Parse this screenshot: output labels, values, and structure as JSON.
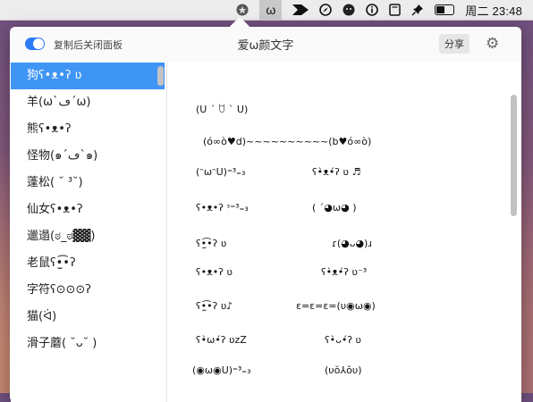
{
  "menubar": {
    "icons": [
      "app-circle-icon",
      "omega-icon",
      "arrow-icon",
      "compass-icon",
      "face-icon",
      "info-icon",
      "document-icon",
      "pin-icon",
      "battery-icon"
    ],
    "omega": "ω",
    "clock": "周二 23:48"
  },
  "toolbar": {
    "toggle_label": "复制后关闭面板",
    "toggle_on": true,
    "title": "爱ω颜文字",
    "share_label": "分享"
  },
  "sidebar": {
    "items": [
      {
        "label": "狗ʕ•ᴥ•ʔ ʋ",
        "active": true
      },
      {
        "label": "羊(ω`ڡ´ω)"
      },
      {
        "label": "熊ʕ•ᴥ•ʔ"
      },
      {
        "label": "怪物(๑´ڡ`๑)"
      },
      {
        "label": "蓬松( ˘ ³˘)"
      },
      {
        "label": "仙女ʕ•ᴥ•ʔ"
      },
      {
        "label": "邋遢(ಠ_ಠ▓▓)"
      },
      {
        "label": "老鼠ʕ•̫͡•ʔ"
      },
      {
        "label": "字符ʕ⊙⊙⊙ʔ"
      },
      {
        "label": "猫(ᐛ)"
      },
      {
        "label": "滑子蘑( ˘ᴗ˘ )"
      }
    ]
  },
  "kaomoji": {
    "left": [
      "(U ´ ꇴ ` U)",
      "(ó∞ò♥d)~~~~~~~~~~(b♥ó∞ò)",
      "(ᵔωᵔU)⁼³₌₃",
      "ʕ•ᴥ•ʔ ᵌ⁼³₌₃",
      "ʕ•̫͡•ʔ ʋ",
      "ʕ•ᴥ•ʔ ʋ",
      "ʕ•̫͡•ʔ ʋ♪",
      "ʕ•̀ω•́ʔ ʋzZ",
      "(◉ω◉U)⁼³₌₃"
    ],
    "right": [
      "ʕ•̀ᴥ•́ʔ ʋ ♬",
      "( ´◕ω◕ )",
      "ɾ(◕ᴗ◕)ɹ",
      "ʕ•̀ᴥ•́ʔ ʋ⁻³",
      "ε=ε=ε=(υ◉ω◉)",
      "ʕ•̀ᴗ•́ʔ ʋ",
      "(υŏ⅄ŏυ)"
    ]
  }
}
